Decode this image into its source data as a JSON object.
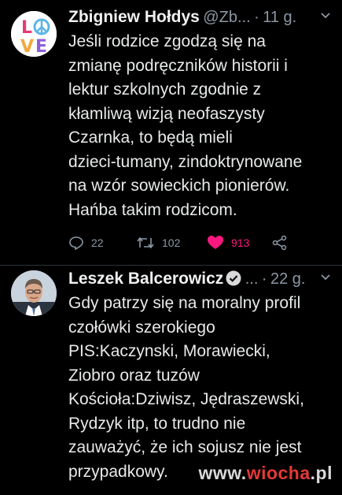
{
  "tweets": [
    {
      "author_name": "Zbigniew Hołdys",
      "handle": "@Zb",
      "ellipsis": "...",
      "separator": "·",
      "time": "11 g.",
      "avatar": "love-peace-logo",
      "text": "Jeśli rodzice zgodzą się na\nzmianę podręczników historii i\nlektur szkolnych zgodnie z\nkłamliwą wizją neofaszysty\nCzarnka, to będą mieli\ndzieci-tumany, zindoktrynowane\nna wzór sowieckich pionierów.\nHańba takim rodzicom.",
      "stats": {
        "replies": "22",
        "retweets": "102",
        "likes": "913"
      }
    },
    {
      "author_name": "Leszek Balcerowicz",
      "verified": true,
      "ellipsis": "...",
      "separator": "·",
      "time": "22 g.",
      "avatar": "profile-photo",
      "text": "Gdy patrzy się na moralny profil\nczołówki szerokiego\nPIS:Kaczynski, Morawiecki,\nZiobro oraz tuzów\nKościoła:Dziwisz, Jędraszewski,\nRydzyk itp, to trudno nie\nzauważyć, że ich sojusz nie jest\nprzypadkowy."
    }
  ],
  "watermark": {
    "prefix": "www.",
    "accent": "wiocha",
    "suffix": ".pl"
  },
  "colors": {
    "background": "#000000",
    "like": "#f91880",
    "muted": "#8b98a5",
    "divider": "#2f3336"
  }
}
